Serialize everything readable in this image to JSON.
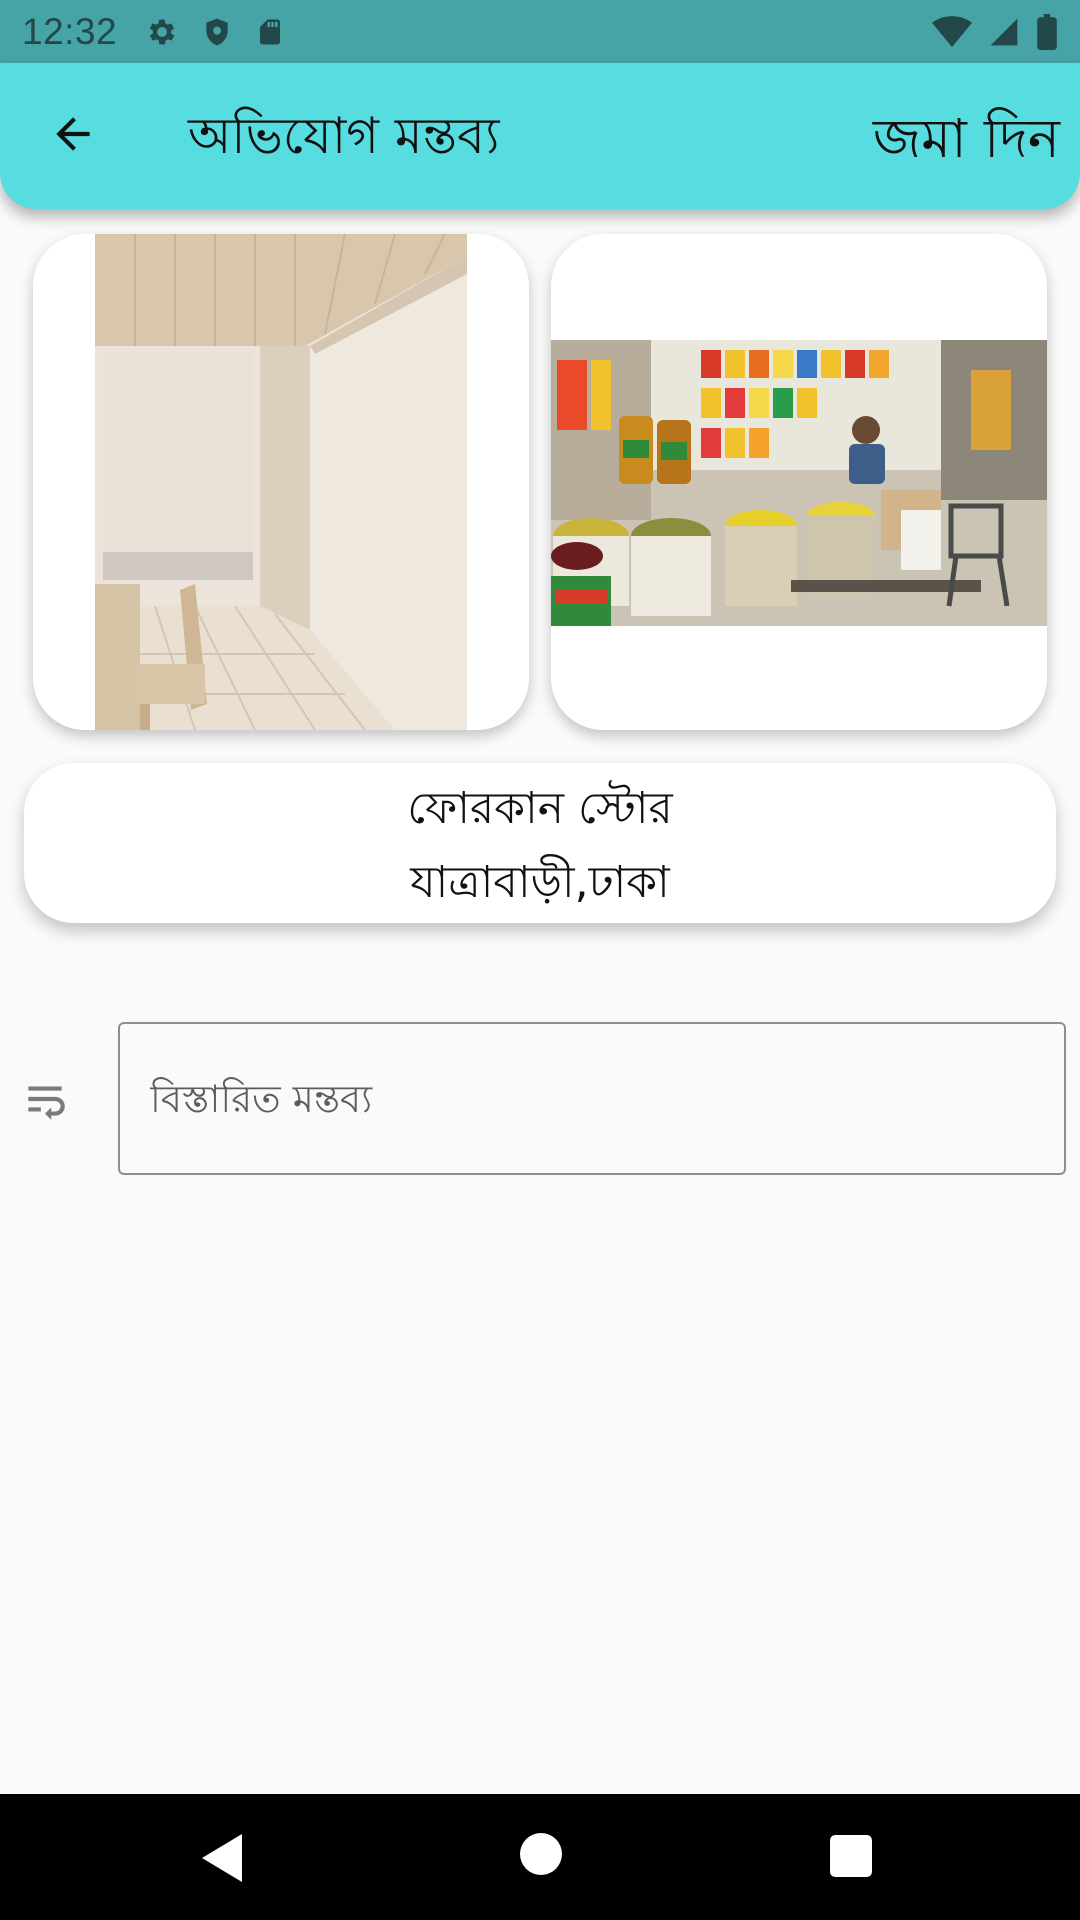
{
  "status_bar": {
    "time": "12:32",
    "left_icons": [
      "settings-icon",
      "shield-icon",
      "sd-card-icon"
    ],
    "right_icons": [
      "wifi-icon",
      "cell-signal-icon",
      "battery-icon"
    ],
    "background": "#46a3a6"
  },
  "app_bar": {
    "title": "অভিযোগ মন্তব্য",
    "submit_label": "জমা দিন",
    "back_icon": "arrow-back-icon",
    "background": "#57dcdf"
  },
  "photos": [
    {
      "name": "room-photo",
      "description_icon": "image"
    },
    {
      "name": "market-photo",
      "description_icon": "image"
    }
  ],
  "shop": {
    "name": "ফোরকান স্টোর",
    "location": "যাত্রাবাড়ী,ঢাকা"
  },
  "comment": {
    "placeholder": "বিস্তারিত মন্তব্য",
    "value": "",
    "icon": "wrap-text-icon"
  },
  "nav_bar": {
    "buttons": [
      "nav-back-icon",
      "nav-home-icon",
      "nav-recents-icon"
    ]
  }
}
